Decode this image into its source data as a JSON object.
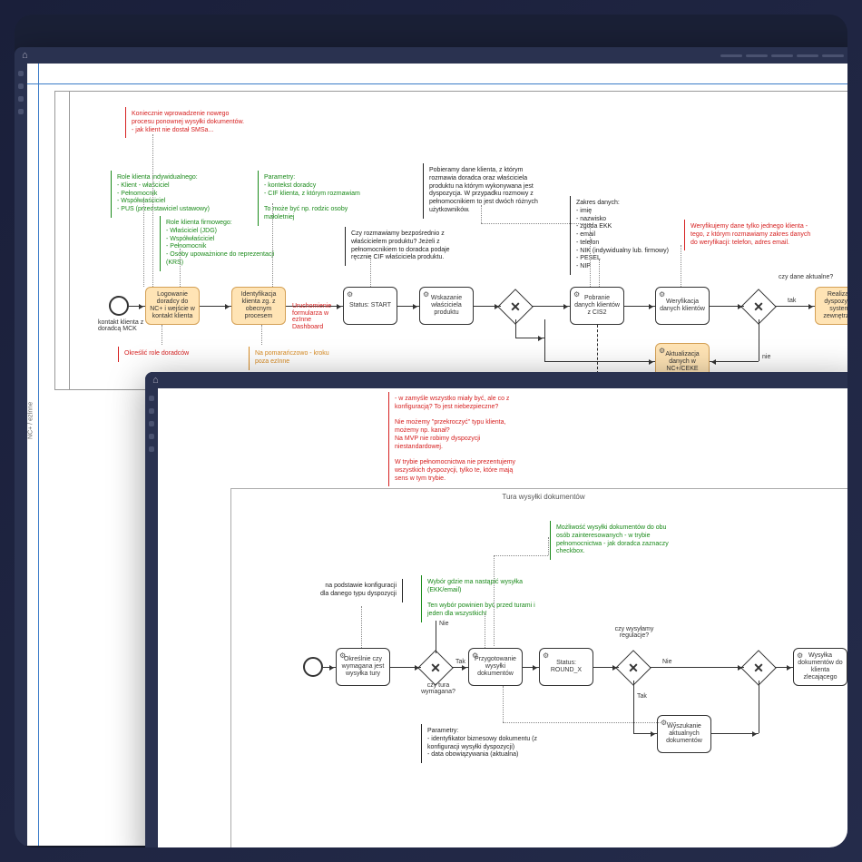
{
  "windows": {
    "w1": {
      "vlabel": "NC+ / ezInne",
      "notes": {
        "topRed": "Koniecznie wprowadzenie nowego procesu ponownej wysyłki dokumentów.\n- jak klient nie dostał SMSa...",
        "roleIndGreen": "Role klienta indywidualnego:\n- Klient - właściciel\n- Pełnomocnik\n- Współwłaściciel\n- PUS (przedstawiciel ustawowy)",
        "roleFirmGreen": "Role klienta firmowego:\n- Właściciel (JDG)\n- Współwłaściciel\n- Pełnomocnik\n- Osoby upoważnione do reprezentacji (KRS)",
        "paramGreen": "Parametry:\n- kontekst doradcy\n- CIF klienta, z którym rozmawiam\n\nTo może być np. rodzic osoby małoletniej",
        "ownerBlack": "Czy rozmawiamy bezpośrednio z właścicielem produktu? Jeżeli z pełnomocnikiem to doradca podaje ręcznie CIF właściciela produktu.",
        "pobieramyBlack": "Pobieramy dane klienta, z którym rozmawia doradca oraz właściciela produktu na którym wykonywana jest dyspozycja. W przypadku rozmowy z pełnomocnikiem to jest dwóch różnych użytkowników.",
        "zakresBlack": "Zakres danych:\n- imię\n- nazwisko\n- zgoda EKK\n- email\n- telefon\n- NIK (indywidualny lub. firmowy)\n- PESEL\n- NIP",
        "verifyRed": "Weryfikujemy dane tylko jednego klienta - tego, z którym rozmawiamy zakres danych do weryfikacji: telefon, adres email.",
        "okreslicRed": "Określić role doradców",
        "pomaranczOrange": "Na pomarańczowo - kroku poza ezInne",
        "uruchRed": "Uruchomienie formularza w ezInne Dashboard"
      },
      "labels": {
        "startEvt": "kontakt klienta z doradcą MCK",
        "czyDane": "czy dane aktualne?",
        "tak": "tak",
        "nie": "nie"
      },
      "tasks": {
        "t1": "Logowanie doradcy do NC+ i wejście w kontakt klienta",
        "t2": "Identyfikacja klienta zg. z obecnym procesem",
        "t3": "Status: START",
        "t4": "Wskazanie właściciela produktu",
        "t5": "Pobranie danych klientów z CIS2",
        "t6": "Weryfikacja danych klientów",
        "t7": "Realizacja dyspozycji w systemie zewnętrznym",
        "t8": "Aktualizacja danych w NC+/CEKE"
      }
    },
    "w2": {
      "laneTitle": "Tura wysyłki dokumentów",
      "notes": {
        "topRed": "- w zamyśle wszystko miały być, ale co z konfiguracją? To jest niebezpieczne?\n\nNie możemy \"przekroczyć\" typu klienta, możemy np. kanał?\nNa MVP nie robimy dyspozycji niestandardowej.\n\nW trybie pełnomocnictwa nie prezentujemy wszystkich dyspozycji, tylko te, które mają sens w tym trybie.",
        "mozliwoscGreen": "Możliwość wysyłki dokumentów do obu osób zainteresowanych - w trybie pełnomocnictwa - jak doradca zaznaczy checkbox.",
        "podstBlack": "na podstawie konfiguracji dla danego typu dyspozycji",
        "wyborGreen": "Wybór gdzie ma nastąpić wysyłka (EKK/email)\n\nTen wybór powinien być przed turami i jeden dla wszystkich!",
        "paramBlack": "Parametry:\n- identyfikator biznesowy dokumentu (z konfiguracji wysyłki dyspozycji)\n- data obowiązywania (aktualna)"
      },
      "labels": {
        "nie": "Nie",
        "tak": "Tak",
        "czyTura": "czy tura wymagana?",
        "czyReg": "czy wysyłamy regulacje?"
      },
      "tasks": {
        "t1": "Określnie czy wymagana jest wysyłka tury",
        "t2": "Przygotowanie wysyłki dokumentów",
        "t3": "Status: ROUND_X",
        "t4": "Wysyłka dokumentów do klienta zlecającego",
        "t5": "Wyszukanie aktualnych dokumentów"
      }
    }
  }
}
